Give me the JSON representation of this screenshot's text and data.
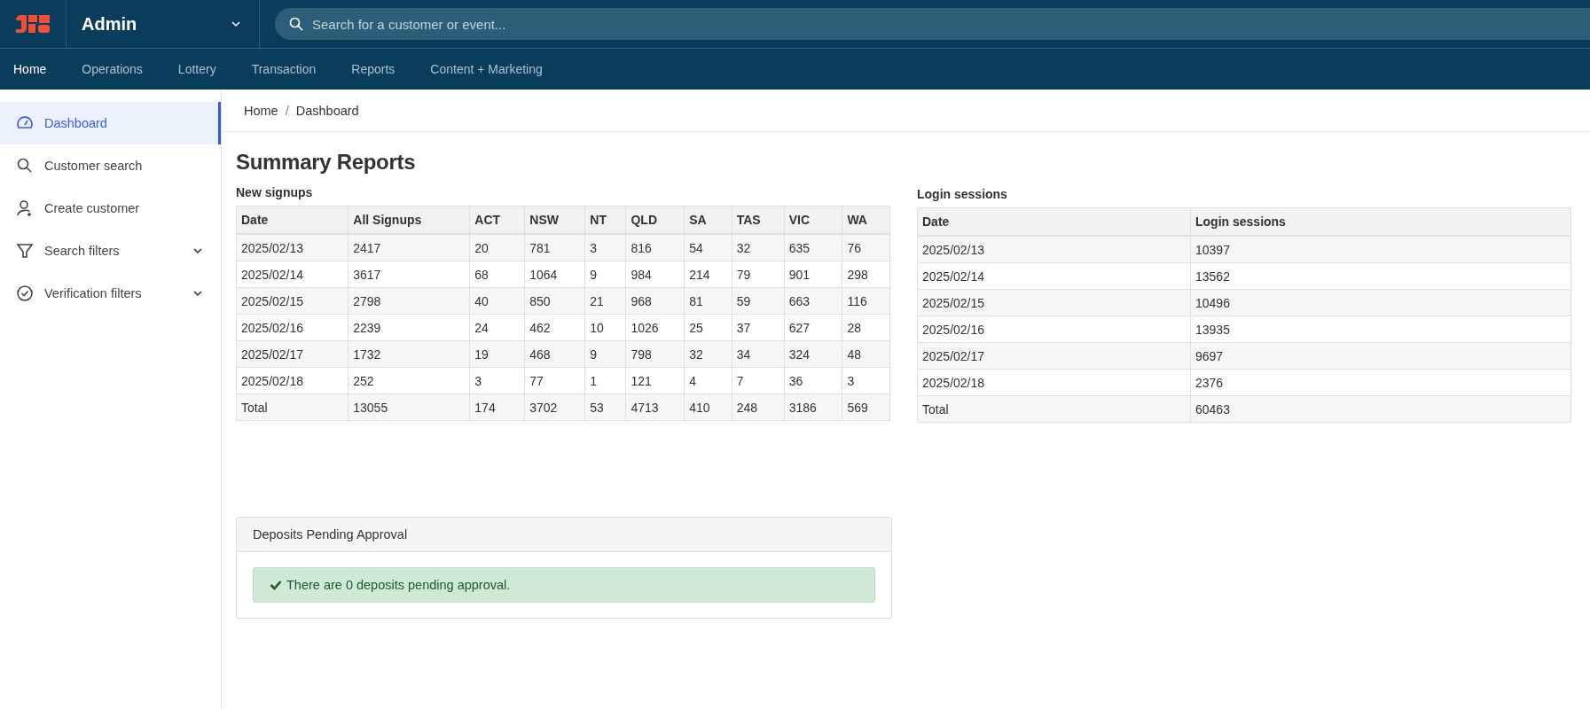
{
  "header": {
    "app_name": "Admin",
    "search": {
      "placeholder": "Search for a customer or event..."
    }
  },
  "nav_tabs": [
    {
      "label": "Home",
      "selected": true
    },
    {
      "label": "Operations",
      "selected": false
    },
    {
      "label": "Lottery",
      "selected": false
    },
    {
      "label": "Transaction",
      "selected": false
    },
    {
      "label": "Reports",
      "selected": false
    },
    {
      "label": "Content + Marketing",
      "selected": false
    }
  ],
  "sidebar": {
    "items": [
      {
        "label": "Dashboard",
        "kind": "link",
        "selected": true
      },
      {
        "label": "Customer search",
        "kind": "link",
        "selected": false
      },
      {
        "label": "Create customer",
        "kind": "link",
        "selected": false
      },
      {
        "label": "Search filters",
        "kind": "group",
        "selected": false,
        "expanded": false
      },
      {
        "label": "Verification filters",
        "kind": "group",
        "selected": false,
        "expanded": false
      }
    ]
  },
  "breadcrumb": [
    "Home",
    "Dashboard"
  ],
  "breadcrumb_separator": "/",
  "title": "Summary Reports",
  "signups": {
    "title": "New signups",
    "columns": [
      "Date",
      "All Signups",
      "ACT",
      "NSW",
      "NT",
      "QLD",
      "SA",
      "TAS",
      "VIC",
      "WA"
    ],
    "rows": [
      [
        "2025/02/13",
        "2417",
        "20",
        "781",
        "3",
        "816",
        "54",
        "32",
        "635",
        "76"
      ],
      [
        "2025/02/14",
        "3617",
        "68",
        "1064",
        "9",
        "984",
        "214",
        "79",
        "901",
        "298"
      ],
      [
        "2025/02/15",
        "2798",
        "40",
        "850",
        "21",
        "968",
        "81",
        "59",
        "663",
        "116"
      ],
      [
        "2025/02/16",
        "2239",
        "24",
        "462",
        "10",
        "1026",
        "25",
        "37",
        "627",
        "28"
      ],
      [
        "2025/02/17",
        "1732",
        "19",
        "468",
        "9",
        "798",
        "32",
        "34",
        "324",
        "48"
      ],
      [
        "2025/02/18",
        "252",
        "3",
        "77",
        "1",
        "121",
        "4",
        "7",
        "36",
        "3"
      ],
      [
        "Total",
        "13055",
        "174",
        "3702",
        "53",
        "4713",
        "410",
        "248",
        "3186",
        "569"
      ]
    ]
  },
  "logins": {
    "title": "Login sessions",
    "columns": [
      "Date",
      "Login sessions"
    ],
    "rows": [
      [
        "2025/02/13",
        "10397"
      ],
      [
        "2025/02/14",
        "13562"
      ],
      [
        "2025/02/15",
        "10496"
      ],
      [
        "2025/02/16",
        "13935"
      ],
      [
        "2025/02/17",
        "9697"
      ],
      [
        "2025/02/18",
        "2376"
      ],
      [
        "Total",
        "60463"
      ]
    ]
  },
  "deposits": {
    "title": "Deposits Pending Approval",
    "message": "There are 0 deposits pending approval."
  }
}
